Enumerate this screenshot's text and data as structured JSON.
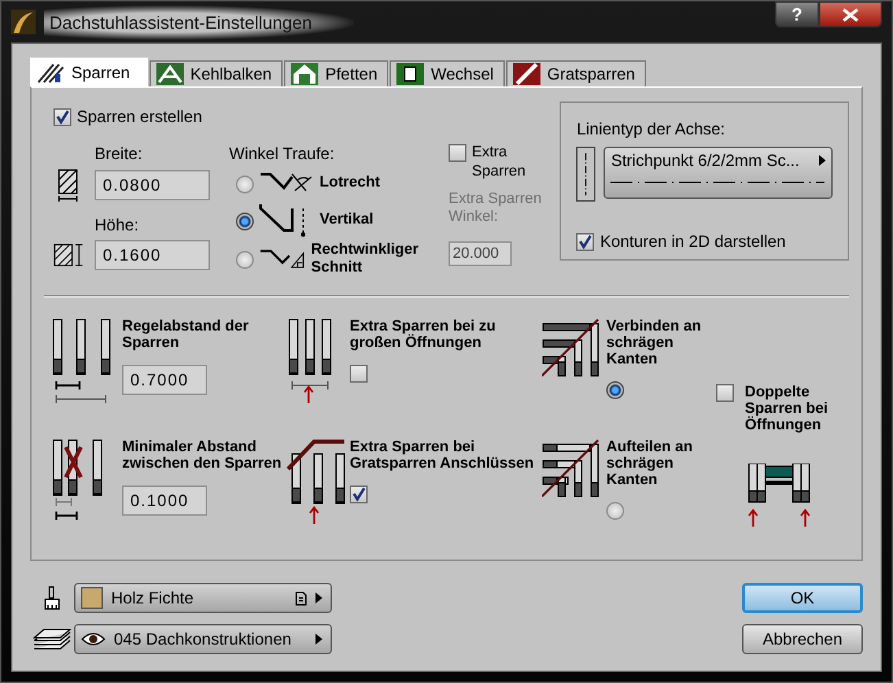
{
  "window": {
    "title": "Dachstuhlassistent-Einstellungen",
    "help_button": "?"
  },
  "tabs": [
    {
      "label": "Sparren",
      "selected": true
    },
    {
      "label": "Kehlbalken",
      "selected": false
    },
    {
      "label": "Pfetten",
      "selected": false
    },
    {
      "label": "Wechsel",
      "selected": false
    },
    {
      "label": "Gratsparren",
      "selected": false
    }
  ],
  "sparren_erstellen": {
    "label": "Sparren erstellen",
    "checked": true
  },
  "breite": {
    "label": "Breite:",
    "value": "0.0800"
  },
  "hoehe": {
    "label": "Höhe:",
    "value": "0.1600"
  },
  "winkel_traufe": {
    "label": "Winkel Traufe:",
    "options": [
      {
        "label": "Lotrecht",
        "selected": false
      },
      {
        "label": "Vertikal",
        "selected": true
      },
      {
        "label": "Rechtwinkliger Schnitt",
        "selected": false
      }
    ]
  },
  "extra_sparren": {
    "label": "Extra Sparren",
    "checked": false
  },
  "extra_sparren_winkel": {
    "label": "Extra Sparren Winkel:",
    "value": "20.000",
    "disabled": true
  },
  "linientyp": {
    "title": "Linientyp der Achse:",
    "value": "Strichpunkt 6/2/2mm Sc..."
  },
  "konturen": {
    "label": "Konturen in 2D darstellen",
    "checked": true
  },
  "regelabstand": {
    "label": "Regelabstand der Sparren",
    "value": "0.7000"
  },
  "extra_oeffnungen": {
    "label": "Extra Sparren bei zu großen Öffnungen",
    "checked": false
  },
  "verbinden": {
    "label": "Verbinden an schrägen Kanten",
    "selected": true
  },
  "minimaler_abstand": {
    "label": "Minimaler Abstand zwischen den Sparren",
    "value": "0.1000"
  },
  "extra_gratsparren": {
    "label": "Extra Sparren bei Gratsparren Anschlüssen",
    "checked": true
  },
  "aufteilen": {
    "label": "Aufteilen an schrägen Kanten",
    "selected": false
  },
  "doppelte": {
    "label": "Doppelte Sparren bei Öffnungen",
    "checked": false
  },
  "material": {
    "value": "Holz Fichte"
  },
  "layer": {
    "value": "045 Dachkonstruktionen"
  },
  "buttons": [
    {
      "label": "OK",
      "kind": "default"
    },
    {
      "label": "Abbrechen",
      "kind": "normal"
    }
  ]
}
